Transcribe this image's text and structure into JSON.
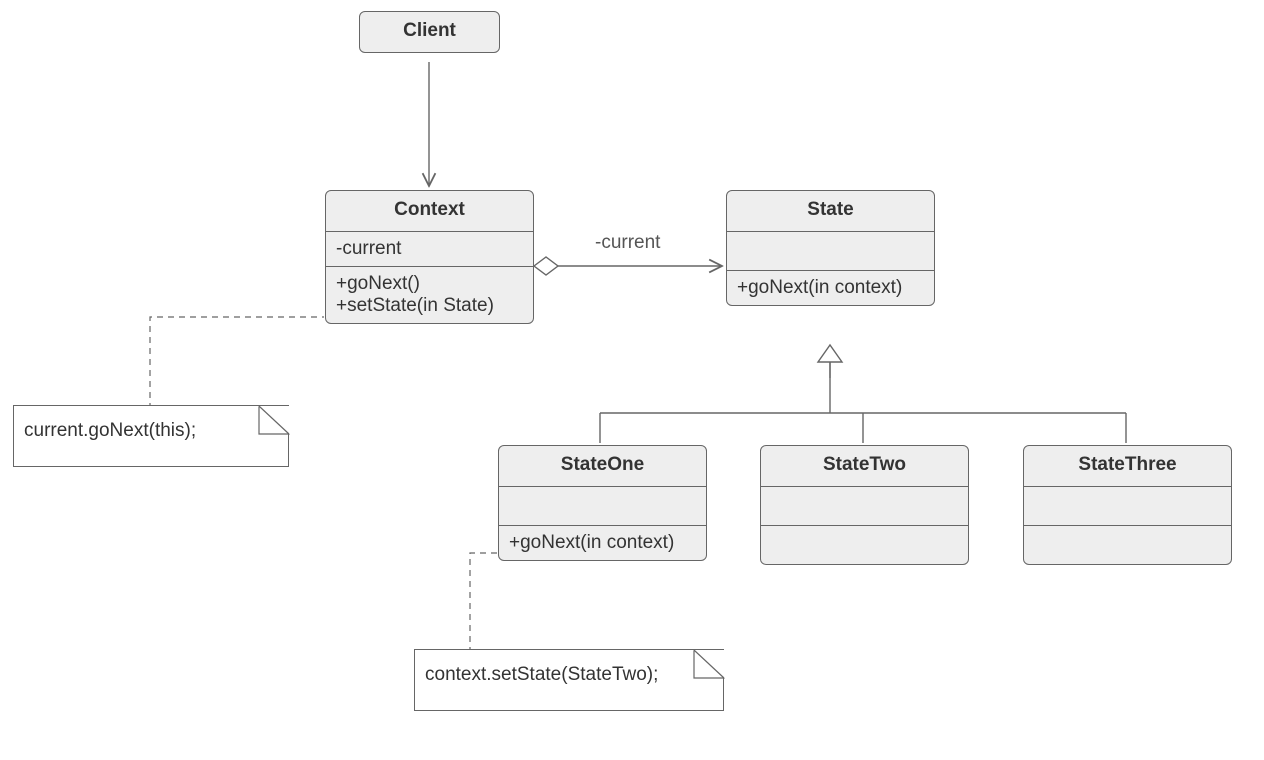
{
  "classes": {
    "client": {
      "name": "Client"
    },
    "context": {
      "name": "Context",
      "attrs": [
        "-current"
      ],
      "ops": [
        "+goNext()",
        "+setState(in State)"
      ]
    },
    "state": {
      "name": "State",
      "ops": [
        "+goNext(in context)"
      ]
    },
    "stateOne": {
      "name": "StateOne",
      "ops": [
        "+goNext(in context)"
      ]
    },
    "stateTwo": {
      "name": "StateTwo"
    },
    "stateThree": {
      "name": "StateThree"
    }
  },
  "edgeLabels": {
    "contextToState": "-current"
  },
  "notes": {
    "note1": "current.goNext(this);",
    "note2": "context.setState(StateTwo);"
  }
}
